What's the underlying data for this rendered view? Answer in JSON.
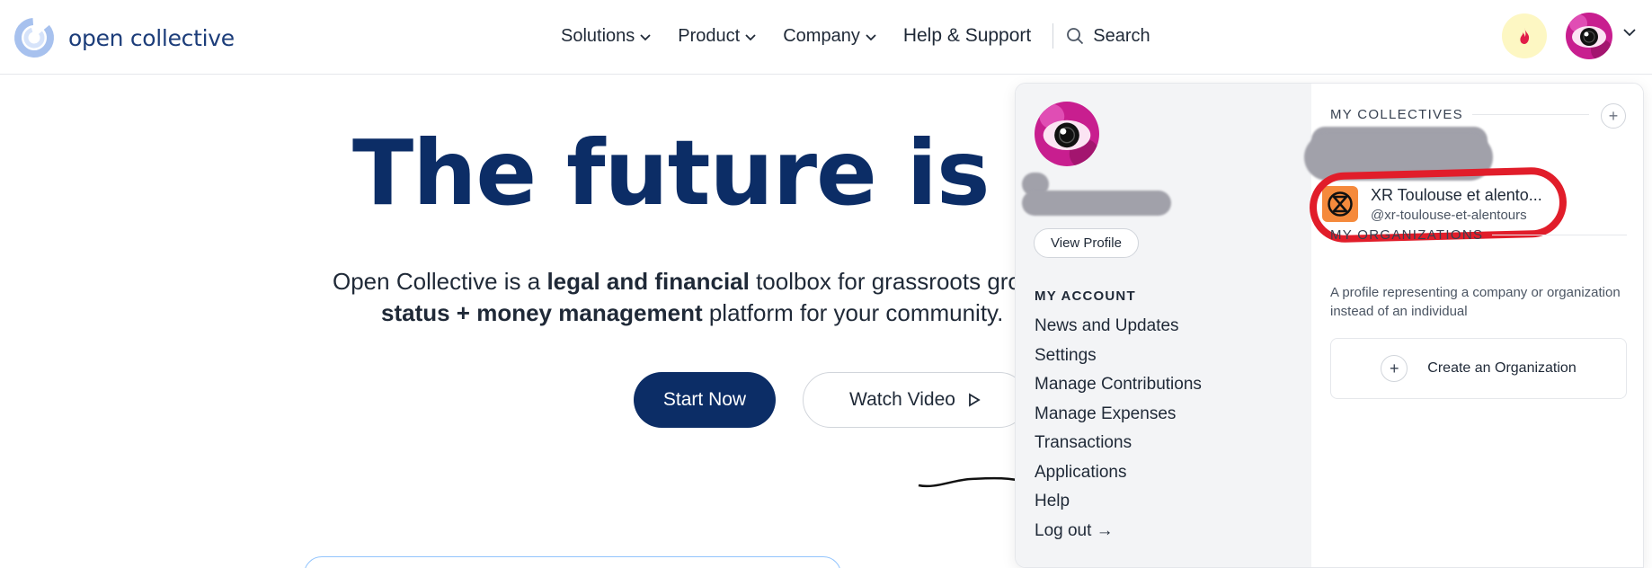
{
  "brand": {
    "name": "open collective"
  },
  "nav": {
    "items": [
      {
        "label": "Solutions",
        "has_dropdown": true
      },
      {
        "label": "Product",
        "has_dropdown": true
      },
      {
        "label": "Company",
        "has_dropdown": true
      },
      {
        "label": "Help & Support",
        "has_dropdown": false
      }
    ],
    "search_label": "Search",
    "icons": {
      "search": "search-icon",
      "notifications": "flame-icon",
      "account_menu": "chevron-down-icon"
    }
  },
  "hero": {
    "title": "The future is col",
    "subtitle_line1": {
      "pre": "Open Collective is a ",
      "bold": "legal and financial",
      "post": " toolbox for grassroots gro"
    },
    "subtitle_line2": {
      "bold": "status + money management",
      "post": " platform for your community. "
    },
    "primary_button": "Start Now",
    "secondary_button": "Watch Video"
  },
  "account_menu": {
    "view_profile": "View Profile",
    "heading": "MY ACCOUNT",
    "items": [
      "News and Updates",
      "Settings",
      "Manage Contributions",
      "Manage Expenses",
      "Transactions",
      "Applications",
      "Help",
      "Log out →"
    ],
    "collectives": {
      "heading": "MY COLLECTIVES",
      "items": [
        {
          "name": "XR Toulouse et alento...",
          "slug": "@xr-toulouse-et-alentours"
        }
      ]
    },
    "organizations": {
      "heading": "MY ORGANIZATIONS",
      "description": "A profile representing a company or organization instead of an individual",
      "create_label": "Create an Organization"
    }
  },
  "colors": {
    "brand_navy": "#0c2d66",
    "highlight_red": "#e11d2a",
    "collective_orange": "#f58a3c",
    "notification_bg": "#fdf7c3"
  }
}
